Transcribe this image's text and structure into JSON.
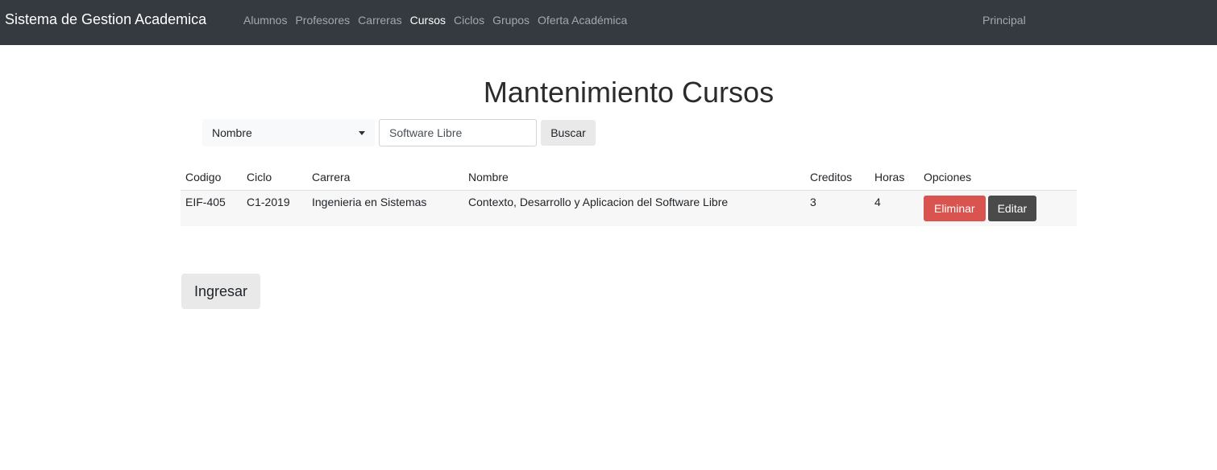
{
  "navbar": {
    "brand": "Sistema de Gestion Academica",
    "links": [
      {
        "label": "Alumnos",
        "active": false
      },
      {
        "label": "Profesores",
        "active": false
      },
      {
        "label": "Carreras",
        "active": false
      },
      {
        "label": "Cursos",
        "active": true
      },
      {
        "label": "Ciclos",
        "active": false
      },
      {
        "label": "Grupos",
        "active": false
      },
      {
        "label": "Oferta Académica",
        "active": false
      }
    ],
    "right_link": "Principal"
  },
  "page": {
    "title": "Mantenimiento Cursos"
  },
  "search": {
    "filter_selected": "Nombre",
    "input_value": "Software Libre",
    "button_label": "Buscar"
  },
  "table": {
    "headers": [
      "Codigo",
      "Ciclo",
      "Carrera",
      "Nombre",
      "Creditos",
      "Horas",
      "Opciones"
    ],
    "rows": [
      {
        "codigo": "EIF-405",
        "ciclo": "C1-2019",
        "carrera": "Ingenieria en Sistemas",
        "nombre": "Contexto, Desarrollo y Aplicacion del Software Libre",
        "creditos": "3",
        "horas": "4",
        "delete_label": "Eliminar",
        "edit_label": "Editar"
      }
    ]
  },
  "actions": {
    "ingresar_label": "Ingresar"
  },
  "colors": {
    "navbar_bg": "#343a40",
    "danger": "#d9534f",
    "dark_button": "#4a4a4a"
  }
}
